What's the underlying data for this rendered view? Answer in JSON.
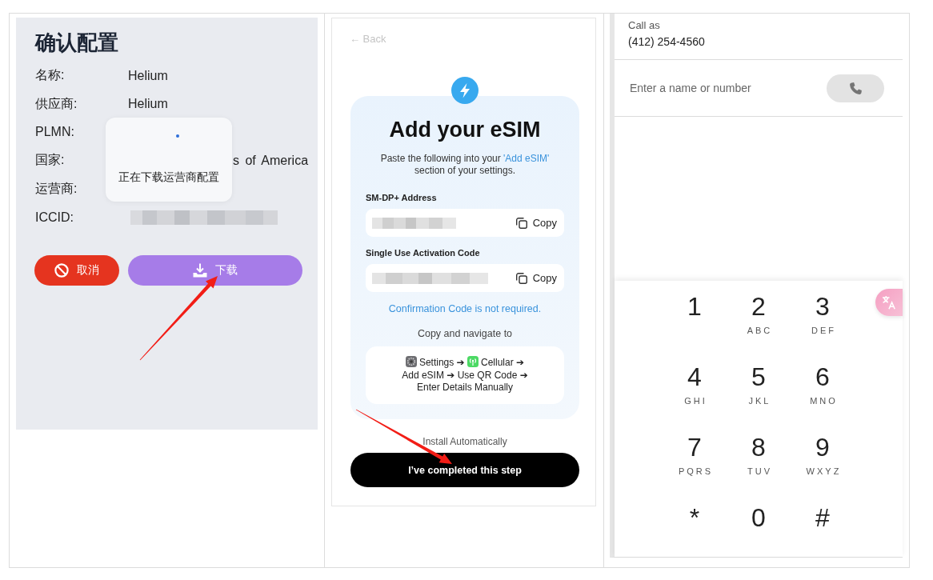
{
  "config_screen": {
    "title": "确认配置",
    "fields": [
      {
        "label": "名称:",
        "value": "Helium",
        "kind": "text"
      },
      {
        "label": "供应商:",
        "value": "Helium",
        "kind": "text"
      },
      {
        "label": "PLMN:",
        "kind": "hidden"
      },
      {
        "label": "国家:",
        "value": "s of America",
        "kind": "partial"
      },
      {
        "label": "运营商:",
        "kind": "hidden"
      },
      {
        "label": "ICCID:",
        "kind": "redacted"
      }
    ],
    "loading_popup": {
      "message": "正在下载运营商配置"
    },
    "buttons": [
      {
        "label": "取消",
        "kind": "cancel"
      },
      {
        "label": "下载",
        "kind": "download"
      }
    ]
  },
  "esim_screen": {
    "back_link": "← Back",
    "title": "Add your eSIM",
    "intro": {
      "before": "Paste the following into your ",
      "link": "'Add eSIM'",
      "after": " section of your settings."
    },
    "fields": [
      {
        "label": "SM-DP+ Address",
        "copy": "Copy"
      },
      {
        "label": "Single Use Activation Code",
        "copy": "Copy"
      }
    ],
    "note": "Confirmation Code is not required.",
    "navigate_label": "Copy and navigate to",
    "path": [
      {
        "label": "Settings ➔",
        "kind": "settings_app"
      },
      {
        "label": "Cellular ➔",
        "kind": "cellular_app"
      },
      {
        "label": "Add eSIM ➔",
        "kind": "menu_item"
      },
      {
        "label": "Use QR Code ➔",
        "kind": "menu_item"
      },
      {
        "label": "Enter Details Manually",
        "kind": "menu_item"
      }
    ],
    "install_link": "Install Automatically",
    "complete_button": "I’ve completed this step"
  },
  "dialer_screen": {
    "call_as_label": "Call as",
    "call_as_number": "(412) 254-4560",
    "search": {
      "placeholder": "Enter a name or number"
    },
    "keys": [
      {
        "digit": "1"
      },
      {
        "digit": "2",
        "letters": "ABC"
      },
      {
        "digit": "3",
        "letters": "DEF"
      },
      {
        "digit": "4",
        "letters": "GHI"
      },
      {
        "digit": "5",
        "letters": "JKL"
      },
      {
        "digit": "6",
        "letters": "MNO"
      },
      {
        "digit": "7",
        "letters": "PQRS"
      },
      {
        "digit": "8",
        "letters": "TUV"
      },
      {
        "digit": "9",
        "letters": "WXYZ"
      },
      {
        "digit": "*"
      },
      {
        "digit": "0"
      },
      {
        "digit": "#"
      }
    ]
  }
}
